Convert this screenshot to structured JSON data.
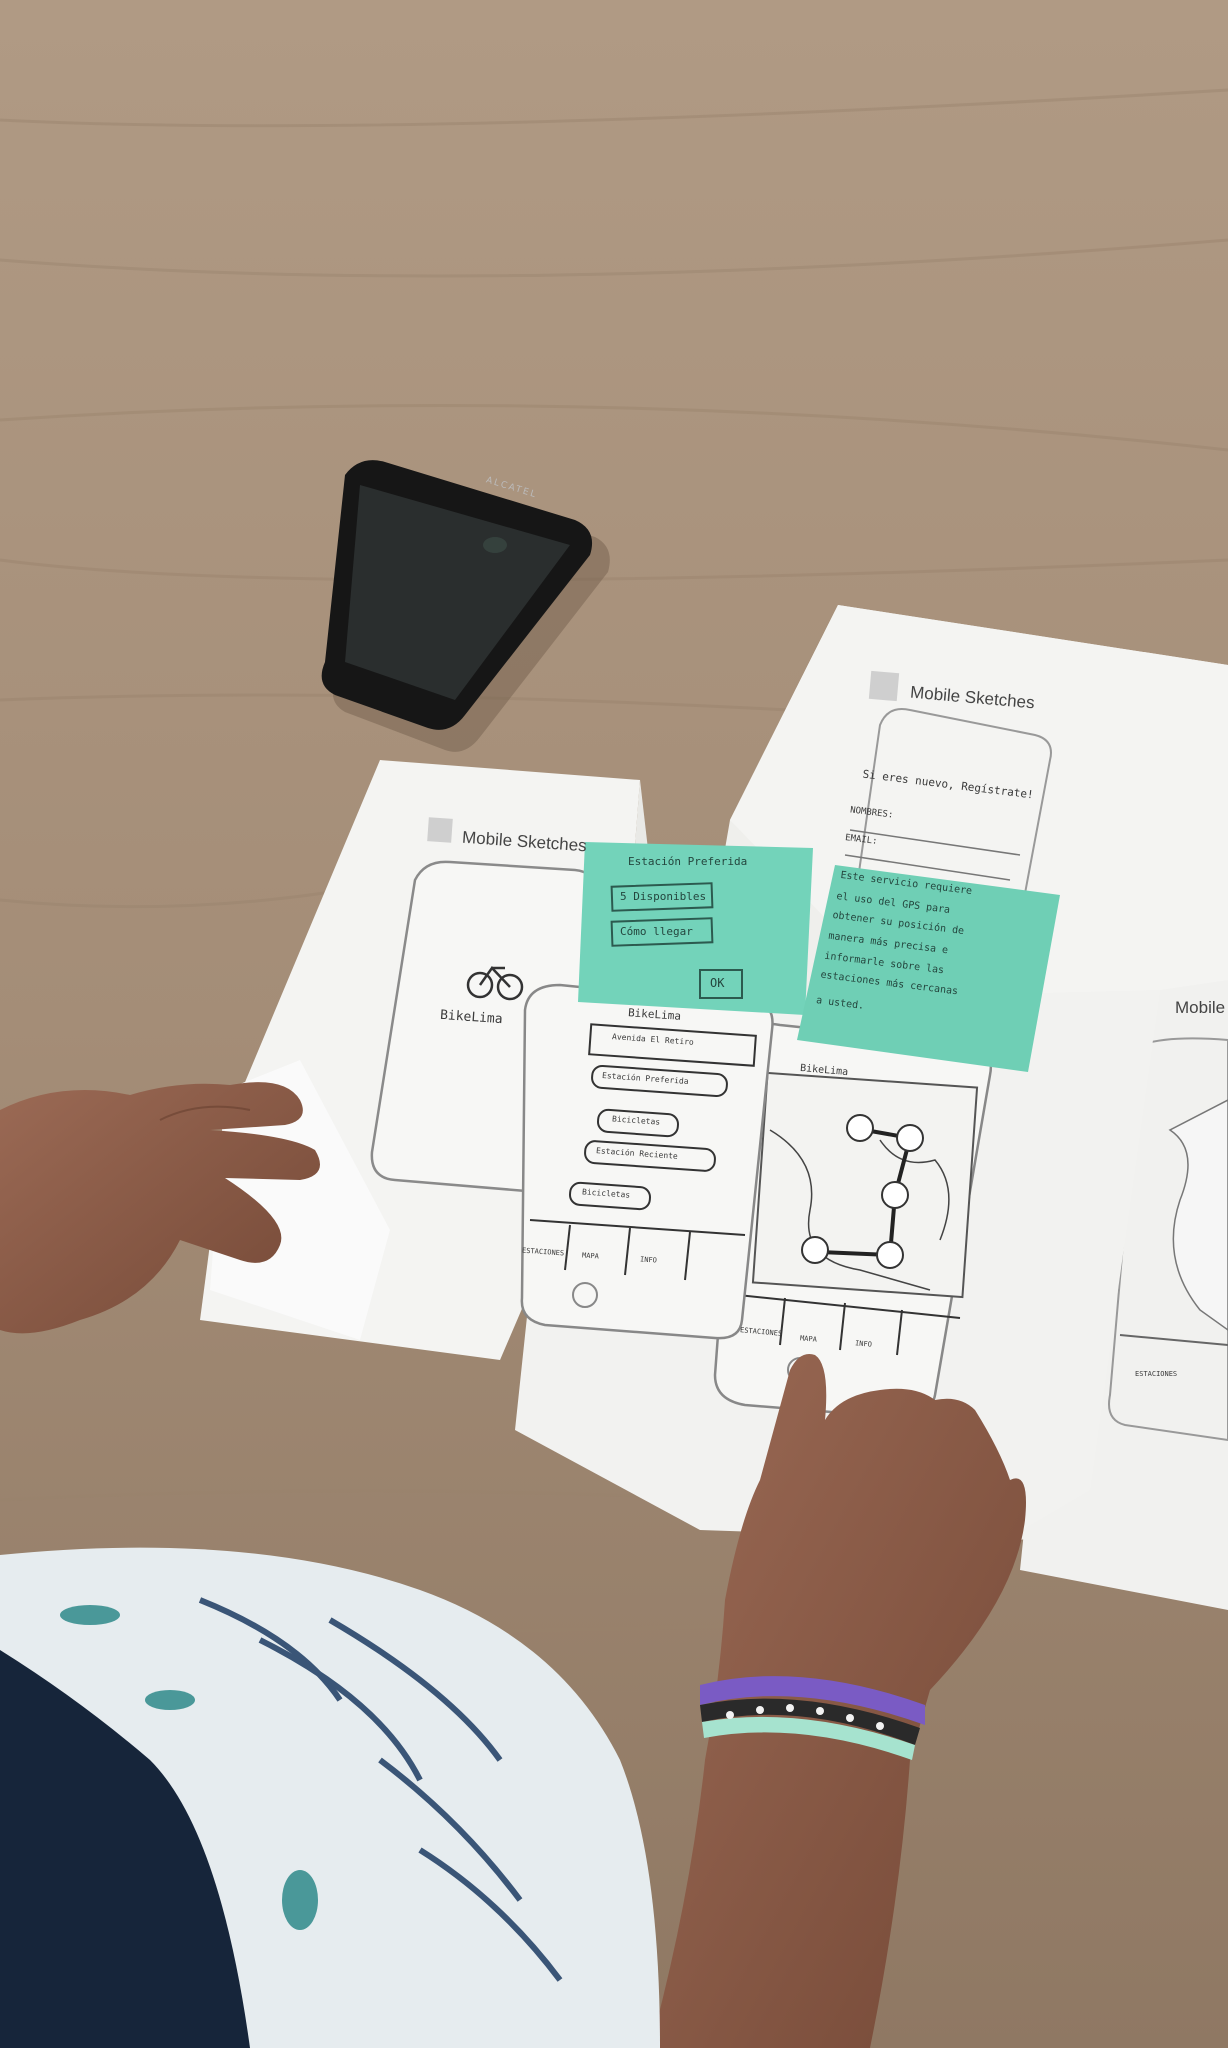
{
  "scene": {
    "description_colors": {
      "table": "#a8927c",
      "paper": "#f3f3f1",
      "sticky_note": "#72d2b8",
      "skin": "#8a5a45",
      "bracelet_purple": "#7a5bc4",
      "bracelet_mint": "#a6e3cf"
    },
    "phone": {
      "brand": "ALCATEL"
    },
    "sheets": [
      {
        "title": "Mobile Sketches"
      },
      {
        "title": "Mobile Sketches"
      },
      {
        "title": "Mobile"
      }
    ],
    "sketch_left": {
      "app_name": "BikeLima"
    },
    "sticky_left": {
      "heading": "Estación Preferida",
      "option_1": "5 Disponibles",
      "option_2": "Cómo llegar",
      "button": "OK"
    },
    "sticky_right": {
      "text_lines": [
        "Este servicio requiere",
        "el uso del GPS para",
        "obtener su posición de",
        "manera más precisa e",
        "informarle sobre las",
        "estaciones más cercanas",
        "a usted."
      ]
    },
    "sketch_middle": {
      "header": "BikeLima",
      "items": [
        "Avenida El Retiro",
        "Estación Preferida",
        "Bicicletas",
        "Estación Reciente",
        "Bicicletas"
      ],
      "tabs": [
        "ESTACIONES",
        "MAPA",
        "INFO"
      ]
    },
    "sketch_register": {
      "title": "Si eres nuevo, Regístrate!",
      "field_1": "NOMBRES:",
      "field_2": "EMAIL:"
    },
    "sketch_map": {
      "header": "BikeLima",
      "tabs": [
        "ESTACIONES",
        "MAPA",
        "INFO"
      ]
    },
    "sketch_far_right": {
      "tabs": [
        "ESTACIONES"
      ]
    }
  }
}
